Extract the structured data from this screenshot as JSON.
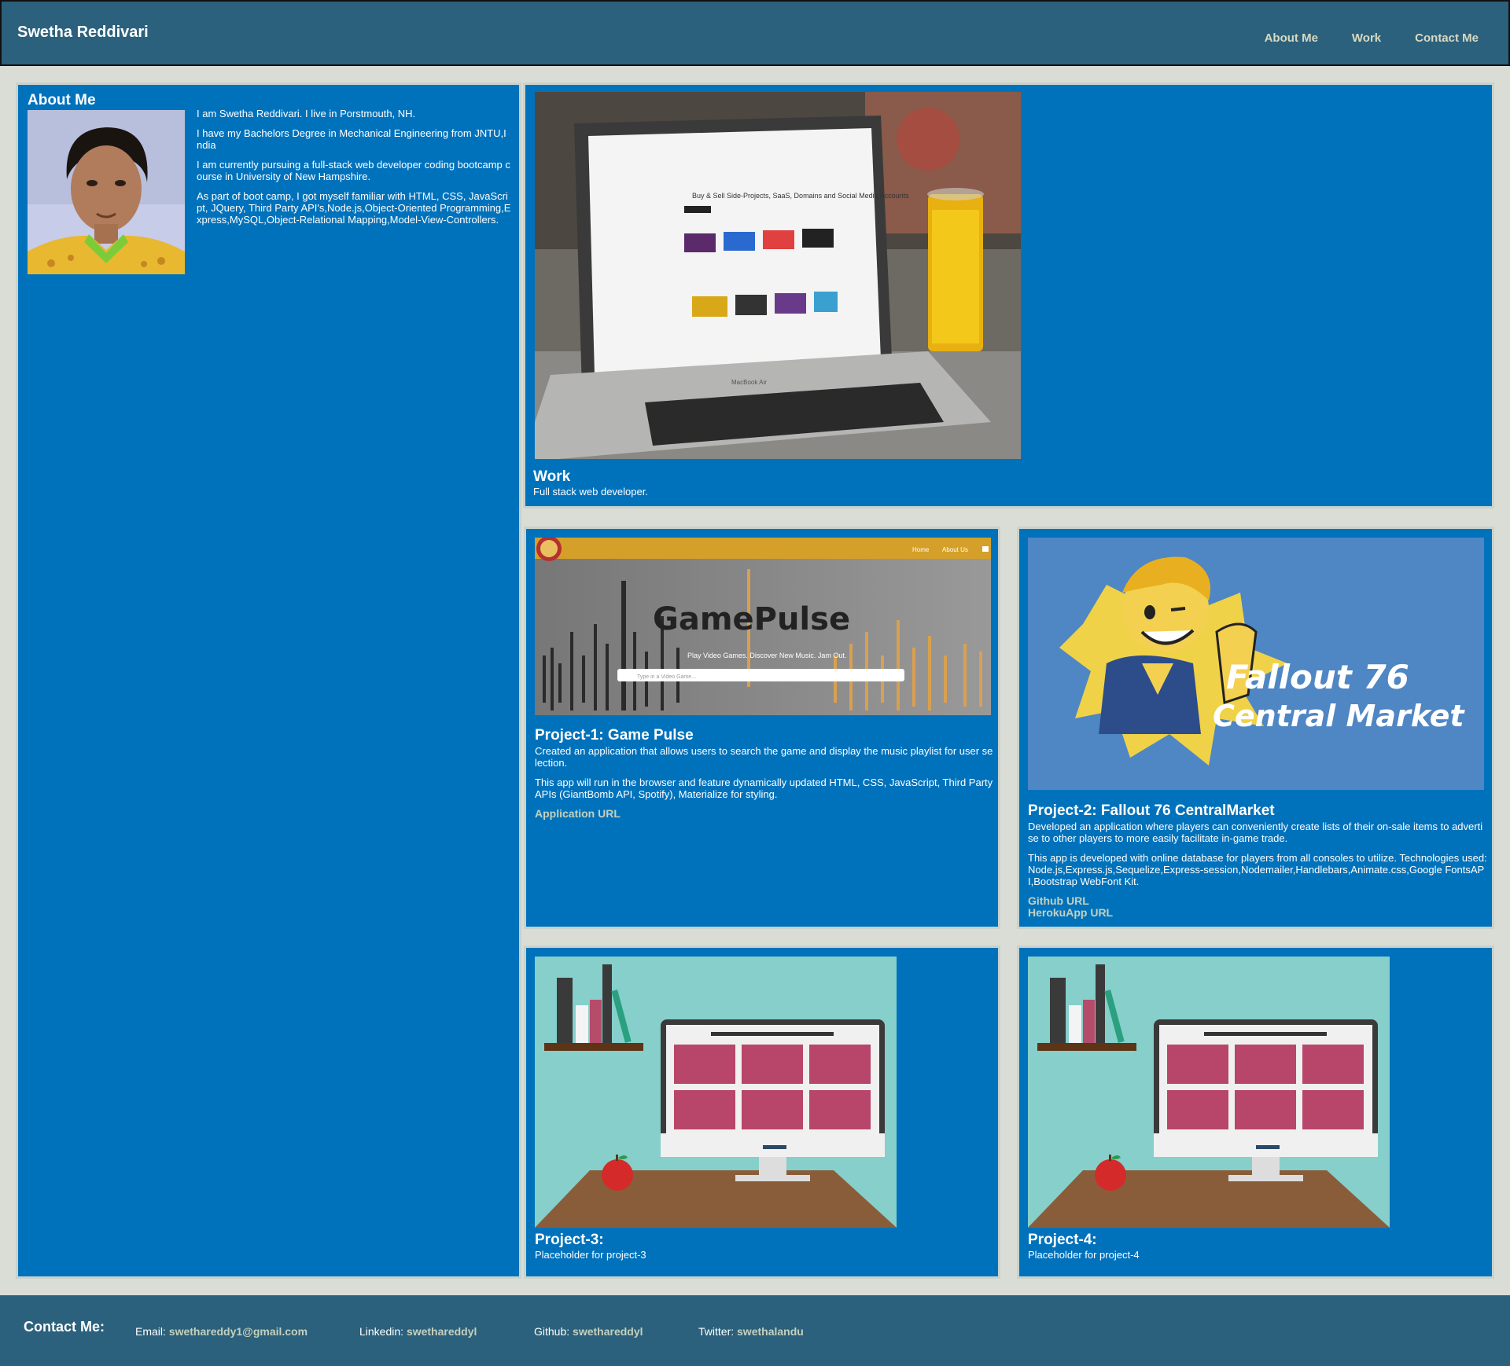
{
  "header": {
    "brand": "Swetha Reddivari",
    "nav": [
      "About Me",
      "Work",
      "Contact Me"
    ]
  },
  "about": {
    "title": "About Me",
    "paragraphs": [
      "I am Swetha Reddivari. I live in Porstmouth, NH.",
      "I have my Bachelors Degree in Mechanical Engineering from JNTU,India",
      "I am currently pursuing a full-stack web developer coding bootcamp course in University of New Hampshire.",
      "As part of boot camp, I got myself familiar with HTML, CSS, JavaScript, JQuery, Third Party API's,Node.js,Object-Oriented Programming,Express,MySQL,Object-Relational Mapping,Model-View-Controllers."
    ]
  },
  "work": {
    "title": "Work",
    "subtitle": "Full stack web developer."
  },
  "projects": [
    {
      "title": "Project-1: Game Pulse",
      "paragraphs": [
        "Created an application that allows users to search the game and display the music playlist for user selection.",
        "This app will run in the browser and feature dynamically updated HTML, CSS, JavaScript, Third Party APIs (GiantBomb API, Spotify), Materialize for styling."
      ],
      "links": [
        "Application URL"
      ],
      "image": {
        "nav": [
          "Home",
          "About Us"
        ],
        "logo": "GamePulse",
        "tagline": "Play Video Games. Discover New Music. Jam Out.",
        "search_placeholder": "Type in a Video Game..."
      }
    },
    {
      "title": "Project-2: Fallout 76 CentralMarket",
      "paragraphs": [
        "Developed an application where players can conveniently create lists of their on-sale items to advertise to other players to more easily facilitate in-game trade.",
        "This app is developed with online database for players from all consoles to utilize. Technologies used: Node.js,Express.js,Sequelize,Express-session,Nodemailer,Handlebars,Animate.css,Google FontsAPI,Bootstrap WebFont Kit."
      ],
      "links": [
        "Github URL",
        "HerokuApp URL"
      ],
      "image": {
        "line1": "Fallout 76",
        "line2": "Central Market"
      }
    },
    {
      "title": "Project-3:",
      "subtitle": "Placeholder for project-3"
    },
    {
      "title": "Project-4:",
      "subtitle": "Placeholder for project-4"
    }
  ],
  "laptop_screen": {
    "headline": "Buy & Sell Side-Projects, SaaS, Domains and Social Media Accounts",
    "brand": "MacBook Air"
  },
  "footer": {
    "title": "Contact Me:",
    "items": [
      {
        "label": "Email:",
        "value": "swethareddy1@gmail.com"
      },
      {
        "label": "Linkedin:",
        "value": "swethareddyl"
      },
      {
        "label": "Github:",
        "value": "swethareddyl"
      },
      {
        "label": "Twitter:",
        "value": "swethalandu"
      }
    ]
  },
  "colors": {
    "header_bg": "#2b617c",
    "panel_bg": "#0072bc",
    "page_bg": "#dadcd6",
    "link": "#c5d0bd"
  }
}
